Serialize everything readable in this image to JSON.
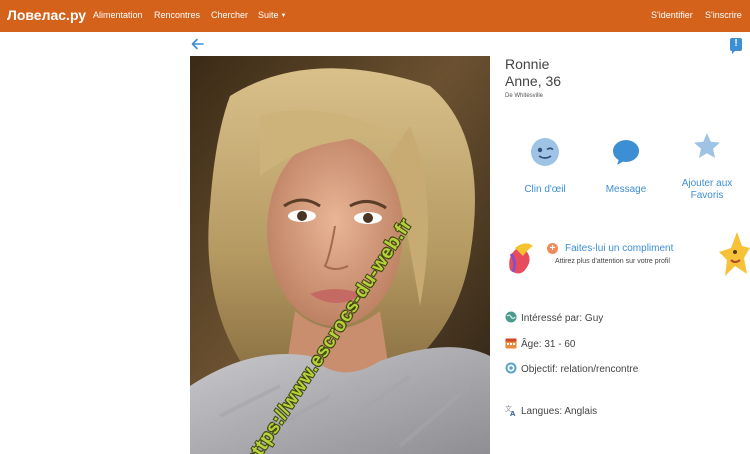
{
  "header": {
    "brand": "Ловелас.ру",
    "nav": [
      "Alimentation",
      "Rencontres",
      "Chercher",
      "Suite"
    ],
    "sign_in": "S'identifier",
    "sign_up": "S'inscrire"
  },
  "profile": {
    "name_line1": "Ronnie",
    "name_line2": "Anne, 36",
    "location": "De Whitesville"
  },
  "photo": {
    "watermark": "https://www.escrocs-du-web.fr"
  },
  "actions": {
    "wink": "Clin d'œil",
    "message": "Message",
    "favorite_line1": "Ajouter aux",
    "favorite_line2": "Favoris"
  },
  "compliment": {
    "title": "Faites-lui un compliment",
    "subtitle": "Attirez plus d'attention sur votre profil"
  },
  "details": {
    "interested": "Intéressé par: Guy",
    "age": "Âge: 31 - 60",
    "goal": "Objectif: relation/rencontre",
    "languages": "Langues: Anglais"
  },
  "colors": {
    "header_bg": "#d4621b",
    "link_blue": "#3d8fd3"
  }
}
